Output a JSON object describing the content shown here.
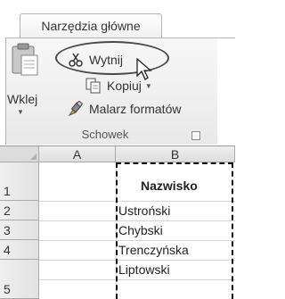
{
  "ribbon": {
    "tab_label": "Narzędzia główne",
    "paste_label": "Wklej",
    "cut_label": "Wytnij",
    "copy_label": "Kopiuj",
    "format_painter_label": "Malarz formatów",
    "group_label": "Schowek"
  },
  "icons": {
    "paste": "clipboard-icon",
    "cut": "scissors-icon",
    "copy": "copy-icon",
    "format_painter": "brush-icon",
    "cursor": "mouse-pointer-icon",
    "launcher": "dialog-launcher-icon"
  },
  "sheet": {
    "columns": [
      "A",
      "B"
    ],
    "rows": [
      "1",
      "2",
      "3",
      "4",
      "5"
    ],
    "cells": {
      "B1": "Nazwisko",
      "B2": "Ustroński",
      "B3": "Chybski",
      "B4": "Trenczyńska",
      "B5": "Liptowski"
    }
  }
}
